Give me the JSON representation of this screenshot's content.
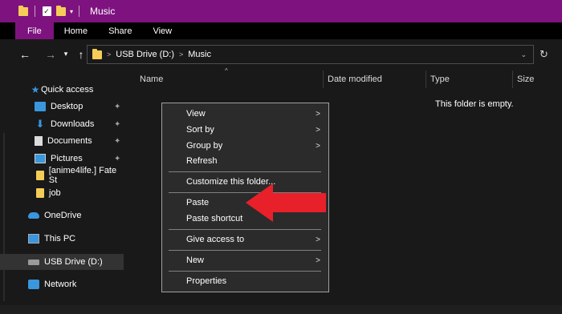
{
  "titlebar": {
    "title": "Music",
    "qa_dropdown": "▾"
  },
  "ribbon": {
    "tabs": [
      "File",
      "Home",
      "Share",
      "View"
    ]
  },
  "address": {
    "back": "←",
    "forward": "→",
    "recent": "▾",
    "up": "↑",
    "crumbs": [
      "USB Drive (D:)",
      "Music"
    ],
    "sep": ">",
    "dropdown": "⌄",
    "refresh": "↻"
  },
  "navpane": {
    "items": [
      {
        "label": "Quick access",
        "icon": "star-icon"
      },
      {
        "label": "Desktop",
        "icon": "desktop-icon",
        "pinned": true
      },
      {
        "label": "Downloads",
        "icon": "download-icon",
        "pinned": true
      },
      {
        "label": "Documents",
        "icon": "documents-icon",
        "pinned": true
      },
      {
        "label": "Pictures",
        "icon": "pictures-icon",
        "pinned": true
      },
      {
        "label": "[anime4life.] Fate St",
        "icon": "folder-icon"
      },
      {
        "label": "job",
        "icon": "folder-icon"
      },
      {
        "label": "OneDrive",
        "icon": "cloud-icon"
      },
      {
        "label": "This PC",
        "icon": "pc-icon"
      },
      {
        "label": "USB Drive (D:)",
        "icon": "usb-drive-icon",
        "selected": true
      },
      {
        "label": "Network",
        "icon": "network-icon"
      }
    ],
    "pin_glyph": "📌"
  },
  "content": {
    "columns": [
      "Name",
      "Date modified",
      "Type",
      "Size"
    ],
    "sort_arrow": "^",
    "empty_text": "This folder is empty."
  },
  "context_menu": {
    "items": [
      {
        "label": "View",
        "submenu": true
      },
      {
        "label": "Sort by",
        "submenu": true
      },
      {
        "label": "Group by",
        "submenu": true
      },
      {
        "label": "Refresh",
        "submenu": false
      },
      {
        "label": "Customize this folder...",
        "submenu": false
      },
      {
        "label": "Paste",
        "submenu": false
      },
      {
        "label": "Paste shortcut",
        "submenu": false
      },
      {
        "label": "Give access to",
        "submenu": true
      },
      {
        "label": "New",
        "submenu": true
      },
      {
        "label": "Properties",
        "submenu": false
      }
    ],
    "submenu_glyph": ">"
  },
  "colors": {
    "accent": "#7e137f",
    "annotation_arrow": "#e8202a"
  }
}
